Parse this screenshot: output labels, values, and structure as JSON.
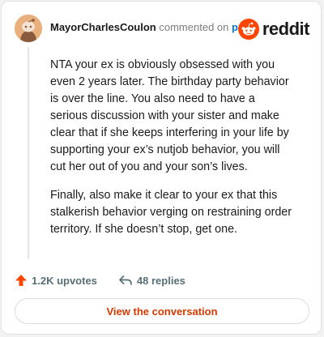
{
  "comment": {
    "username": "MayorCharlesCoulon",
    "action_text": "commented on",
    "post_link": "post",
    "paragraphs": [
      "NTA your ex is obviously obsessed with you even 2 years later. The birthday party behavior is over the line. You also need to have a serious discussion with your sister and make clear that if she keeps interfering in your life by supporting your ex’s nutjob behavior, you will cut her out of you and your son’s lives.",
      "Finally, also make it clear to your ex that this stalkerish behavior verging on restraining order territory. If she doesn’t stop, get one."
    ]
  },
  "logo": {
    "text": "reddit",
    "icon": "reddit-snoo-icon"
  },
  "stats": {
    "upvotes": "1.2K upvotes",
    "replies": "48 replies",
    "upvote_icon": "upvote-arrow-icon",
    "reply_icon": "reply-arrow-icon"
  },
  "cta": {
    "label": "View the conversation"
  },
  "colors": {
    "brand_orange": "#ff4500",
    "link_blue": "#0079d3",
    "cta_text": "#d93900",
    "meta_gray": "#576f76"
  }
}
